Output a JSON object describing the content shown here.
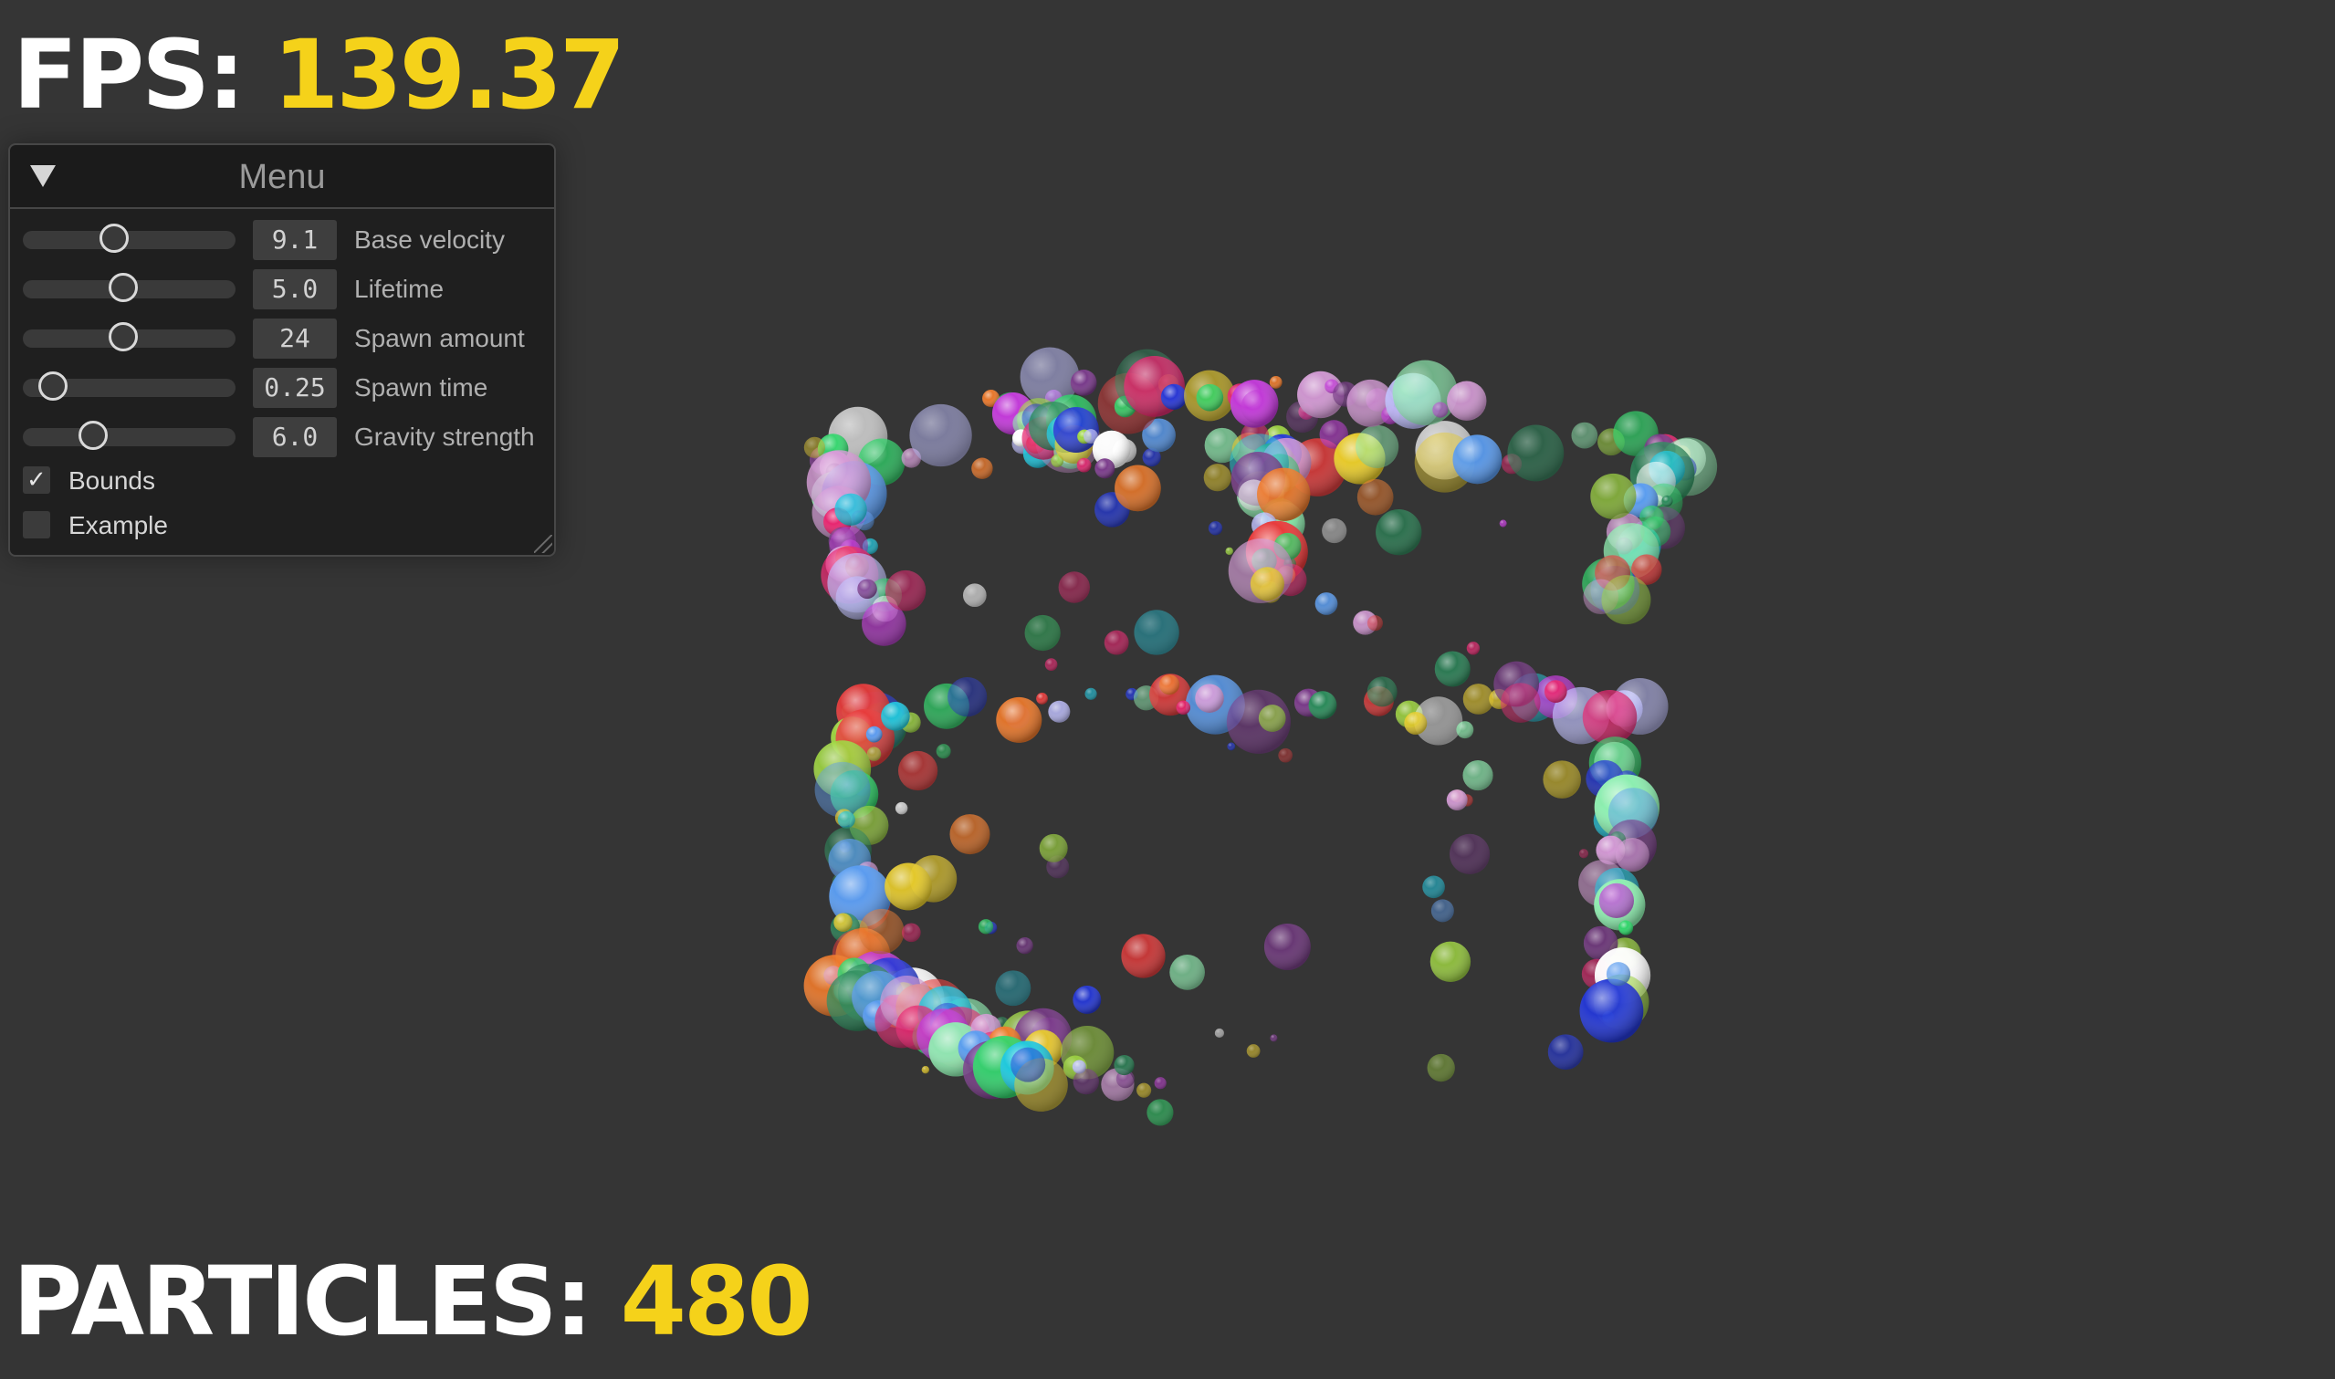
{
  "hud": {
    "fps_label": "FPS:",
    "fps_value": "139.37",
    "particles_label": "PARTICLES:",
    "particles_value": "480"
  },
  "menu": {
    "title": "Menu",
    "sliders": [
      {
        "label": "Base velocity",
        "value": "9.1",
        "level": 0.43
      },
      {
        "label": "Lifetime",
        "value": "5.0",
        "level": 0.47
      },
      {
        "label": "Spawn amount",
        "value": "24",
        "level": 0.47
      },
      {
        "label": "Spawn time",
        "value": "0.25",
        "level": 0.14
      },
      {
        "label": "Gravity strength",
        "value": "6.0",
        "level": 0.33
      }
    ],
    "checkboxes": [
      {
        "label": "Bounds",
        "checked": true
      },
      {
        "label": "Example",
        "checked": false
      }
    ]
  },
  "colors": {
    "background": "#353535",
    "accent_yellow": "#f5d21a",
    "panel": "#1f1f1f"
  }
}
